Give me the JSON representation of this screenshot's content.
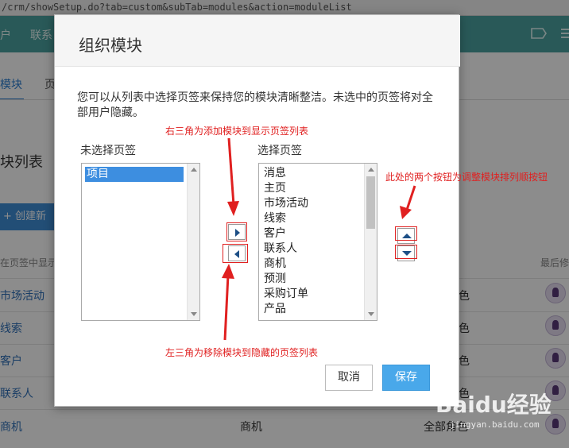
{
  "browser": {
    "url": "/crm/showSetup.do?tab=custom&subTab=modules&action=moduleList"
  },
  "topnav": {
    "items": [
      "户",
      "联系"
    ]
  },
  "background": {
    "tabs": [
      "模块",
      "页"
    ],
    "section_title": "块列表",
    "create_button": "创建新模",
    "col_head_left": "在页签中显示",
    "col_head_right": "最后修",
    "rows": [
      {
        "name": "市场活动",
        "role": "色"
      },
      {
        "name": "线索",
        "role": "色"
      },
      {
        "name": "客户",
        "role": "色"
      },
      {
        "name": "联系人",
        "role": "色"
      },
      {
        "name": "商机",
        "middle": "商机",
        "role": "全部角色"
      }
    ]
  },
  "modal": {
    "title": "组织模块",
    "description": "您可以从列表中选择页签来保持您的模块清晰整洁。未选中的页签将对全部用户隐藏。",
    "left_list": {
      "label": "未选择页签",
      "items": [
        "项目"
      ],
      "selected_item": "项目"
    },
    "right_list": {
      "label": "选择页签",
      "items": [
        "消息",
        "主页",
        "市场活动",
        "线索",
        "客户",
        "联系人",
        "商机",
        "预测",
        "采购订单",
        "产品"
      ]
    },
    "buttons": {
      "cancel": "取消",
      "save": "保存"
    }
  },
  "annotations": {
    "right_arrow_note": "右三角为添加模块到显示页签列表",
    "updown_note": "此处的两个按钮为调整模块排列顺按钮",
    "left_arrow_note": "左三角为移除模块到隐藏的页签列表"
  },
  "watermark": {
    "brand": "Baidu经验",
    "url": "jingyan.baidu.com"
  },
  "colors": {
    "nav_bg": "#4ba3a0",
    "accent_blue": "#3d8ee0",
    "save_blue": "#49a8ea",
    "annotation_red": "#e02020"
  }
}
